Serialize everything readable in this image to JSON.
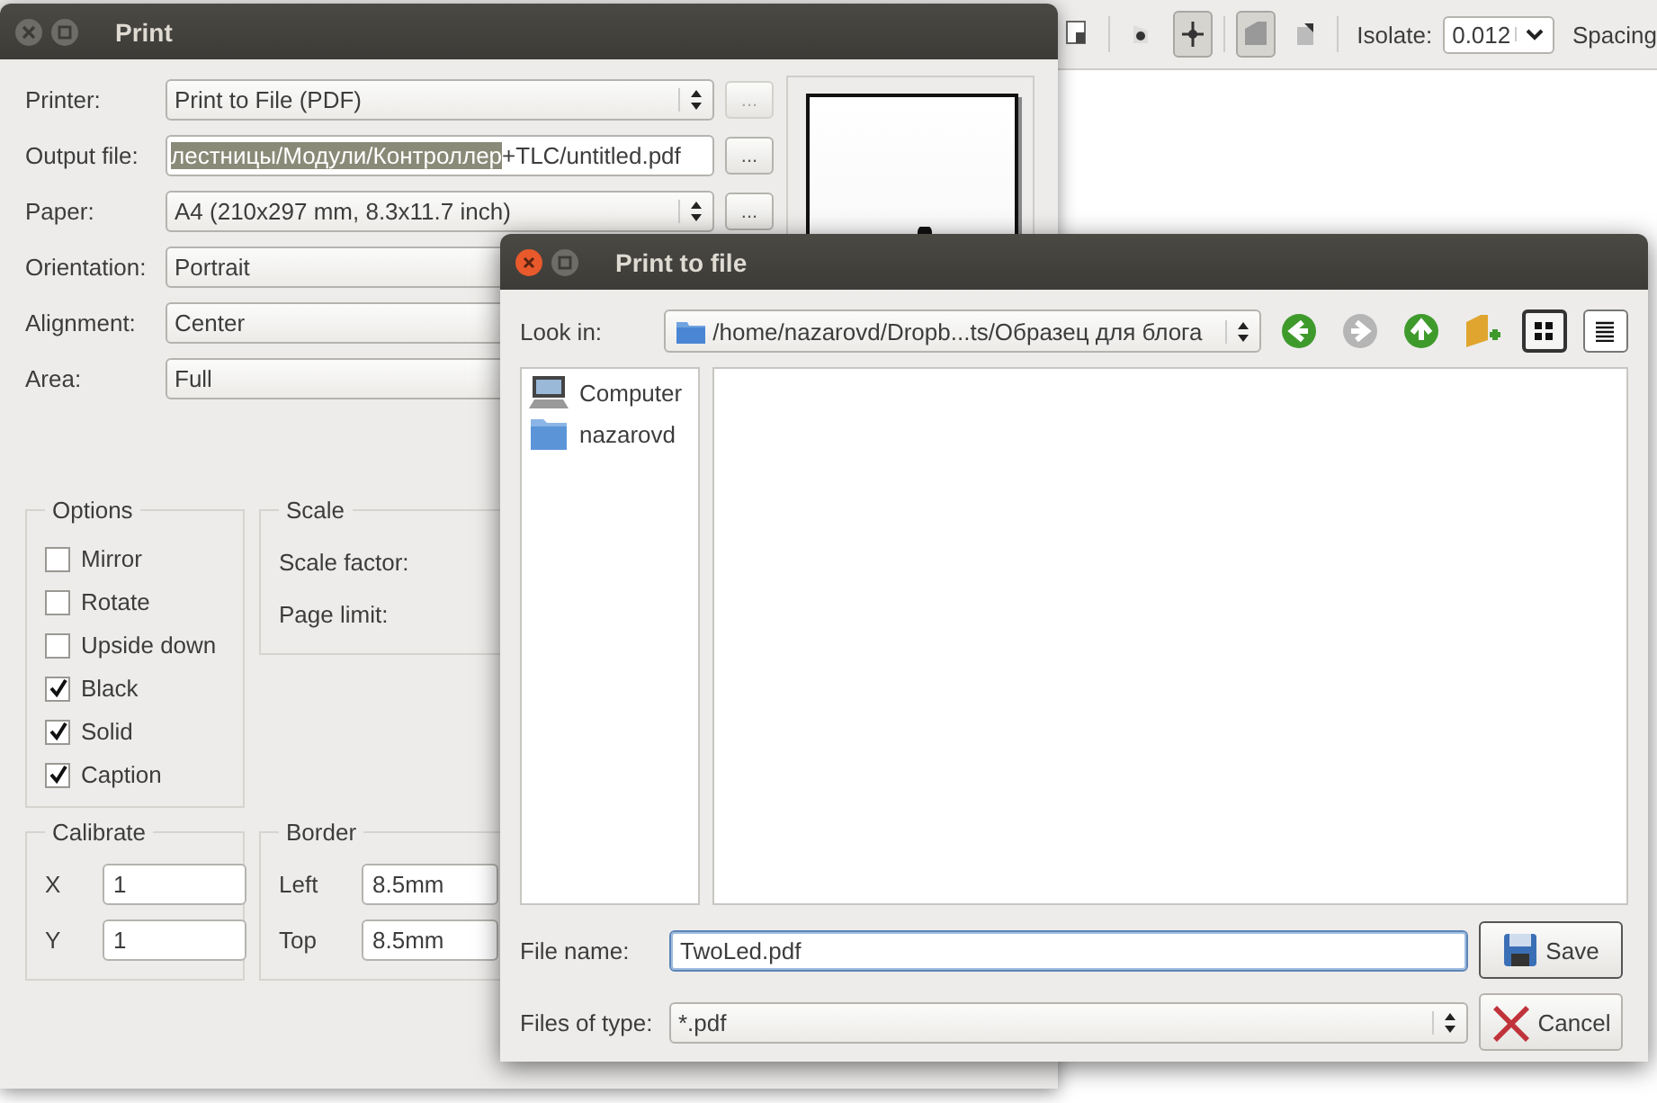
{
  "toolbar": {
    "buttons": [
      {
        "kind": "page",
        "selected": false
      },
      {
        "kind": "dot",
        "selected": false
      },
      {
        "kind": "crosshair",
        "selected": true
      },
      {
        "kind": "wedge",
        "selected": true
      },
      {
        "kind": "corner",
        "selected": false
      }
    ],
    "isolate_label": "Isolate:",
    "isolate_value": "0.012",
    "spacing_label": "Spacing"
  },
  "print_window": {
    "title": "Print",
    "rows": [
      {
        "label": "Printer:",
        "kind": "combo",
        "value": "Print to File (PDF)",
        "browse": "...",
        "browse_disabled": true
      },
      {
        "label": "Output file:",
        "kind": "path",
        "selected_text": "лестницы/Модули/Контроллер",
        "text": "+TLC/untitled.pdf",
        "browse": "...",
        "browse_disabled": false
      },
      {
        "label": "Paper:",
        "kind": "combo",
        "value": "A4 (210x297 mm, 8.3x11.7 inch)",
        "browse": "...",
        "browse_disabled": false
      },
      {
        "label": "Orientation:",
        "kind": "combo",
        "value": "Portrait"
      },
      {
        "label": "Alignment:",
        "kind": "combo",
        "value": "Center"
      },
      {
        "label": "Area:",
        "kind": "combo",
        "value": "Full"
      }
    ],
    "options": {
      "title": "Options",
      "items": [
        {
          "label": "Mirror",
          "checked": false
        },
        {
          "label": "Rotate",
          "checked": false
        },
        {
          "label": "Upside down",
          "checked": false
        },
        {
          "label": "Black",
          "checked": true
        },
        {
          "label": "Solid",
          "checked": true
        },
        {
          "label": "Caption",
          "checked": true
        }
      ]
    },
    "scale": {
      "title": "Scale",
      "labels": [
        "Scale factor:",
        "Page limit:"
      ]
    },
    "calibrate": {
      "title": "Calibrate",
      "fields": [
        {
          "label": "X",
          "value": "1"
        },
        {
          "label": "Y",
          "value": "1"
        }
      ]
    },
    "border": {
      "title": "Border",
      "fields": [
        {
          "label": "Left",
          "value": "8.5mm"
        },
        {
          "label": "Top",
          "value": "8.5mm"
        }
      ]
    }
  },
  "file_dialog": {
    "title": "Print to file",
    "look_in_label": "Look in:",
    "path": "/home/nazarovd/Dropb...ts/Образец для блога",
    "nav_buttons": [
      {
        "kind": "back",
        "disabled": false
      },
      {
        "kind": "forward",
        "disabled": true
      },
      {
        "kind": "up",
        "disabled": false
      },
      {
        "kind": "new-folder",
        "disabled": false
      }
    ],
    "view_buttons": [
      {
        "kind": "icon-view",
        "selected": true
      },
      {
        "kind": "detail-view",
        "selected": false
      }
    ],
    "places": [
      {
        "kind": "computer",
        "label": "Computer"
      },
      {
        "kind": "folder",
        "label": "nazarovd"
      }
    ],
    "file_name_label": "File name:",
    "file_name": "TwoLed.pdf",
    "type_label": "Files of type:",
    "file_type": "*.pdf",
    "save": "Save",
    "cancel": "Cancel"
  }
}
